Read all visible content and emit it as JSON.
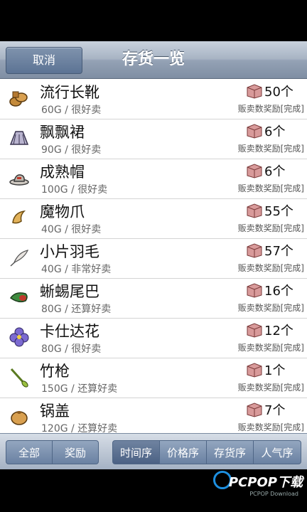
{
  "header": {
    "cancel_label": "取消",
    "title": "存货一览"
  },
  "items": [
    {
      "name": "流行长靴",
      "sub": "60G / 很好卖",
      "count": "50个",
      "reward": "贩卖数奖励[完成]",
      "icon": "boots-icon"
    },
    {
      "name": "飘飘裙",
      "sub": "90G / 很好卖",
      "count": "6个",
      "reward": "贩卖数奖励[完成]",
      "icon": "skirt-icon"
    },
    {
      "name": "成熟帽",
      "sub": "100G / 很好卖",
      "count": "6个",
      "reward": "贩卖数奖励[完成]",
      "icon": "hat-icon"
    },
    {
      "name": "魔物爪",
      "sub": "40G / 很好卖",
      "count": "55个",
      "reward": "贩卖数奖励[完成]",
      "icon": "claw-icon"
    },
    {
      "name": "小片羽毛",
      "sub": "40G / 非常好卖",
      "count": "57个",
      "reward": "贩卖数奖励[完成]",
      "icon": "feather-icon"
    },
    {
      "name": "蜥蜴尾巴",
      "sub": "80G / 还算好卖",
      "count": "16个",
      "reward": "贩卖数奖励[完成]",
      "icon": "lizard-tail-icon"
    },
    {
      "name": "卡仕达花",
      "sub": "80G / 很好卖",
      "count": "12个",
      "reward": "贩卖数奖励[完成]",
      "icon": "flower-icon"
    },
    {
      "name": "竹枪",
      "sub": "150G / 还算好卖",
      "count": "1个",
      "reward": "贩卖数奖励[完成]",
      "icon": "bamboo-spear-icon"
    },
    {
      "name": "锅盖",
      "sub": "120G / 还算好卖",
      "count": "7个",
      "reward": "贩卖数奖励[完成]",
      "icon": "pot-lid-icon"
    }
  ],
  "filters": {
    "all": "全部",
    "reward": "奖励"
  },
  "sorts": {
    "time": "时间序",
    "price": "价格序",
    "stock": "存货序",
    "popular": "人气序"
  },
  "watermark": {
    "text": "PCPOP下载",
    "sub": "PCPOP Download"
  }
}
